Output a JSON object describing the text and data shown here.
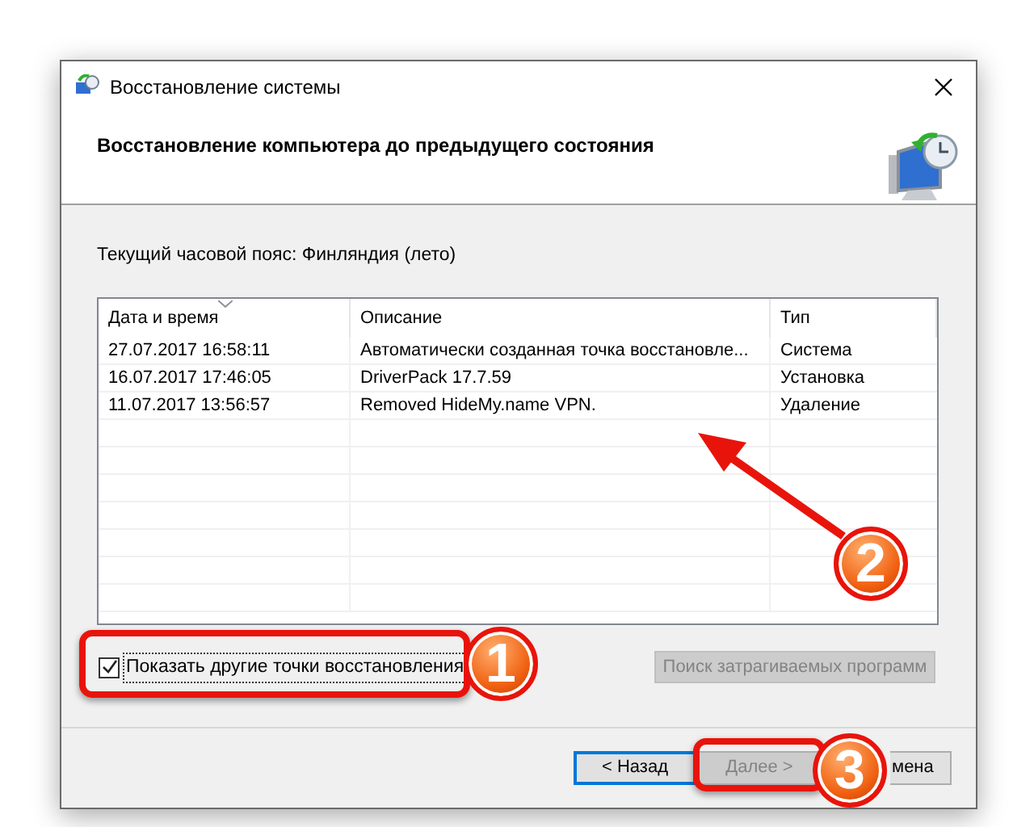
{
  "window": {
    "title": "Восстановление системы"
  },
  "header": {
    "title": "Восстановление компьютера до предыдущего состояния"
  },
  "timezone": "Текущий часовой пояс: Финляндия (лето)",
  "table": {
    "columns": [
      "Дата и время",
      "Описание",
      "Тип"
    ],
    "rows": [
      {
        "date": "27.07.2017 16:58:11",
        "description": "Автоматически созданная точка восстановле...",
        "type": "Система"
      },
      {
        "date": "16.07.2017 17:46:05",
        "description": "DriverPack 17.7.59",
        "type": "Установка"
      },
      {
        "date": "11.07.2017 13:56:57",
        "description": "Removed HideMy.name VPN.",
        "type": "Удаление"
      }
    ]
  },
  "show_more": {
    "label": "Показать другие точки восстановления",
    "checked": true
  },
  "scan_button": {
    "label": "Поиск затрагиваемых программ",
    "disabled": true
  },
  "buttons": [
    {
      "label": "< Назад",
      "disabled": false,
      "focused": true
    },
    {
      "label": "Далее >",
      "disabled": true,
      "focused": false
    },
    {
      "label": "мена",
      "disabled": false,
      "focused": false
    }
  ],
  "annotations": [
    {
      "number": "1"
    },
    {
      "number": "2"
    },
    {
      "number": "3"
    }
  ]
}
